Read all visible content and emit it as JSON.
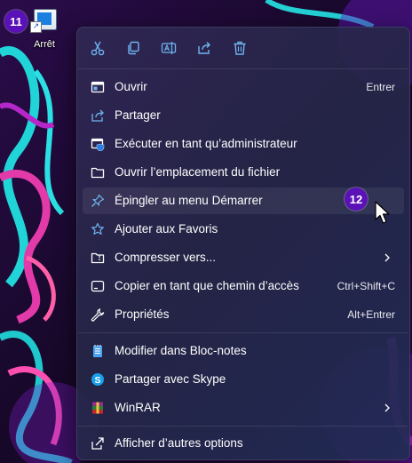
{
  "desktop": {
    "shortcut_label": "Arrêt",
    "step_badge_1": "11",
    "step_badge_2": "12"
  },
  "toolbar": {
    "cut": "cut-icon",
    "copy": "copy-icon",
    "rename": "rename-icon",
    "share": "share-icon",
    "delete": "delete-icon"
  },
  "menu": {
    "items": [
      {
        "label": "Ouvrir",
        "accelerator": "Entrer",
        "icon": "open-icon"
      },
      {
        "label": "Partager",
        "icon": "share-icon"
      },
      {
        "label": "Exécuter en tant qu’administrateur",
        "icon": "admin-shield-icon"
      },
      {
        "label": "Ouvrir l’emplacement du fichier",
        "icon": "folder-icon"
      },
      {
        "label": "Épingler au menu Démarrer",
        "icon": "pin-icon"
      },
      {
        "label": "Ajouter aux Favoris",
        "icon": "star-icon"
      },
      {
        "label": "Compresser vers...",
        "icon": "zip-folder-icon",
        "submenu": true
      },
      {
        "label": "Copier en tant que chemin d’accès",
        "accelerator": "Ctrl+Shift+C",
        "icon": "copy-path-icon"
      },
      {
        "label": "Propriétés",
        "accelerator": "Alt+Entrer",
        "icon": "wrench-icon"
      }
    ],
    "apps": [
      {
        "label": "Modifier dans Bloc-notes",
        "icon": "notepad-icon"
      },
      {
        "label": "Partager avec Skype",
        "icon": "skype-icon"
      },
      {
        "label": "WinRAR",
        "icon": "winrar-icon",
        "submenu": true
      }
    ],
    "more": {
      "label": "Afficher d’autres options",
      "icon": "more-options-icon"
    }
  },
  "colors": {
    "menu_bg": "#2c2c52",
    "icon_accent": "#6fb4f0",
    "badge": "#5a12b8",
    "text": "#ffffff"
  }
}
